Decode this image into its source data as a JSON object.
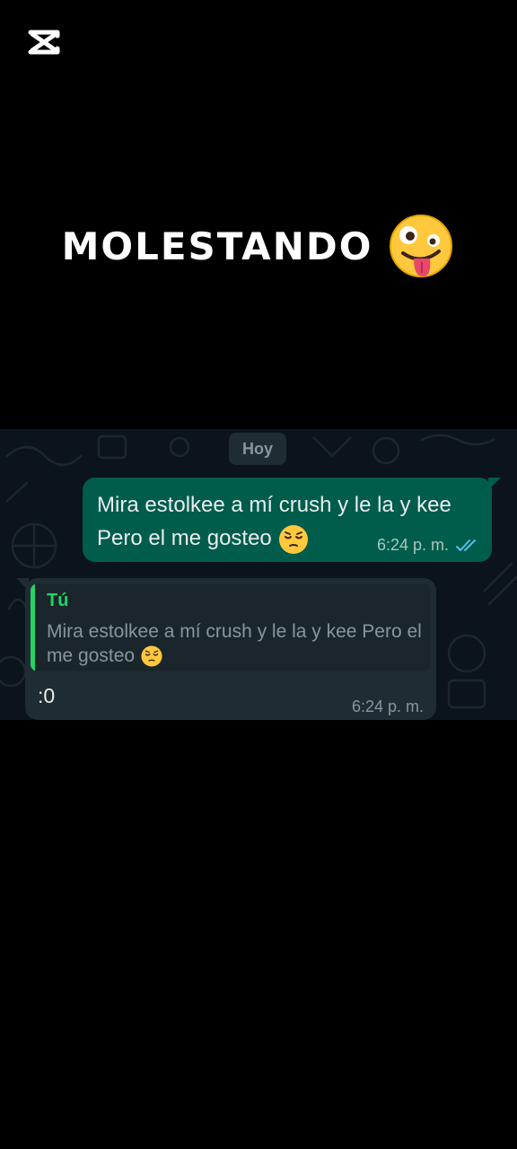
{
  "app": {
    "logo_icon": "capcut-logo-icon"
  },
  "headline": {
    "text": "MOLESTANDO",
    "emoji": "zany-face-emoji"
  },
  "chat": {
    "day_separator": "Hoy",
    "outgoing": {
      "text": "Mira estolkee a mí crush y le la y kee Pero el me gosteo",
      "emoji": "pensive-face-emoji",
      "time": "6:24 p. m.",
      "status_icon": "double-check-read-icon"
    },
    "incoming": {
      "quote_author": "Tú",
      "quote_text": "Mira estolkee a mí crush y le la y kee Pero el me gosteo",
      "quote_emoji": "pensive-face-emoji",
      "text": ":0",
      "time": "6:24 p. m."
    }
  },
  "colors": {
    "chat_background": "#0b141a",
    "outgoing_bubble": "#005c4b",
    "incoming_bubble": "#202c33",
    "quote_accent": "#25d366",
    "read_ticks": "#53bdeb"
  }
}
